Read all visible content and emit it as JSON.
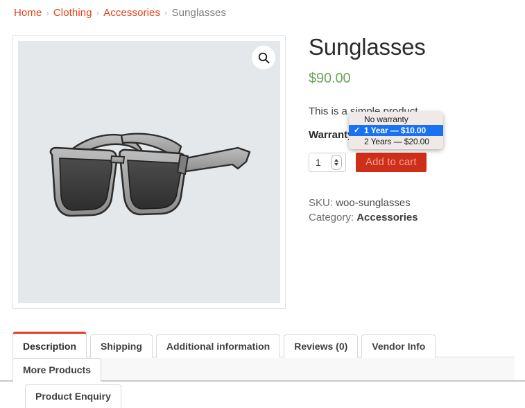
{
  "breadcrumb": {
    "items": [
      {
        "label": "Home",
        "current": false
      },
      {
        "label": "Clothing",
        "current": false
      },
      {
        "label": "Accessories",
        "current": false
      },
      {
        "label": "Sunglasses",
        "current": true
      }
    ],
    "separator": "›"
  },
  "gallery": {
    "zoom_icon": "magnifier-icon",
    "image_alt": "Sunglasses",
    "background_color": "#e4e8eb"
  },
  "summary": {
    "title": "Sunglasses",
    "price": "$90.00",
    "short_description": "This is a simple product.",
    "variation_label": "Warranty",
    "quantity": "1",
    "add_to_cart_label": "Add to cart",
    "sku_label": "SKU:",
    "sku_value": "woo-sunglasses",
    "category_label": "Category:",
    "category_value": "Accessories",
    "price_color": "#6aa65a",
    "accent_color": "#e2401c",
    "button_color": "#cf2e18"
  },
  "select_popup": {
    "options": [
      {
        "label": "No warranty",
        "selected": false
      },
      {
        "label": "1 Year — $10.00",
        "selected": true
      },
      {
        "label": "2 Years — $20.00",
        "selected": false
      }
    ],
    "check_glyph": "✓",
    "highlight_color": "#1a72f2"
  },
  "tabs": {
    "row1": [
      {
        "label": "Description",
        "active": true
      },
      {
        "label": "Shipping",
        "active": false
      },
      {
        "label": "Additional information",
        "active": false
      },
      {
        "label": "Reviews (0)",
        "active": false
      },
      {
        "label": "Vendor Info",
        "active": false
      },
      {
        "label": "More Products",
        "active": false
      }
    ],
    "row2": [
      {
        "label": "Product Enquiry",
        "active": false
      }
    ]
  }
}
